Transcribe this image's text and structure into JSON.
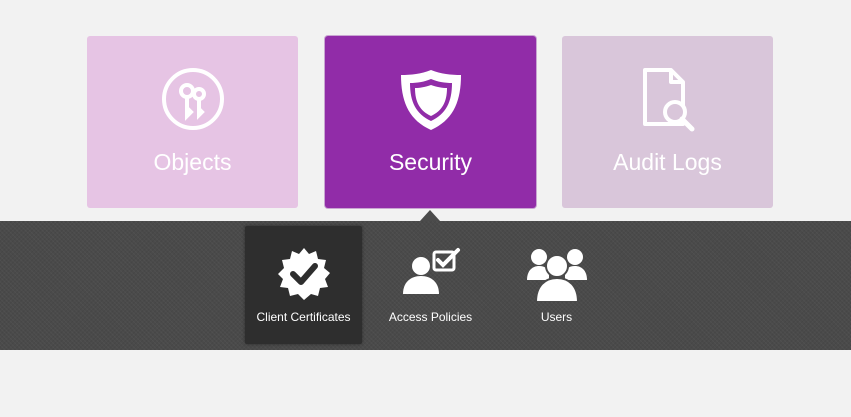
{
  "tiles": [
    {
      "label": "Objects",
      "icon": "keys-icon"
    },
    {
      "label": "Security",
      "icon": "shield-icon",
      "selected": true
    },
    {
      "label": "Audit Logs",
      "icon": "document-search-icon"
    }
  ],
  "submenu": [
    {
      "label": "Client Certificates",
      "icon": "certificate-badge-icon",
      "selected": true
    },
    {
      "label": "Access Policies",
      "icon": "user-check-icon"
    },
    {
      "label": "Users",
      "icon": "users-group-icon"
    }
  ],
  "colors": {
    "background": "#f2f2f2",
    "tile_objects": "#e6c4e4",
    "tile_security_active": "#912ca8",
    "tile_audit": "#d9c6da",
    "submenu_panel": "#4a4a4a",
    "submenu_selected": "#2e2e2e"
  }
}
